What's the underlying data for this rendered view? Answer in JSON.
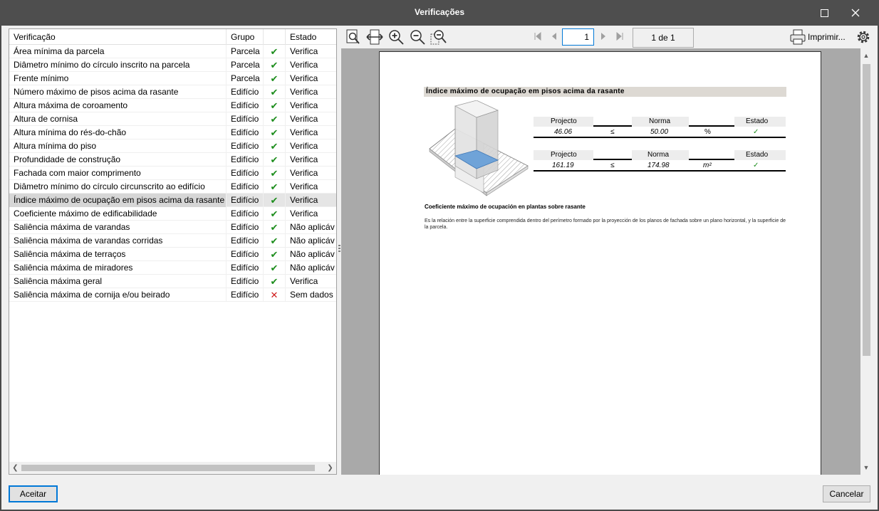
{
  "window": {
    "title": "Verificações"
  },
  "list": {
    "columns": {
      "name": "Verificação",
      "group": "Grupo",
      "state": "Estado"
    },
    "rows": [
      {
        "name": "Área mínima da parcela",
        "group": "Parcela",
        "status": "ok",
        "state": "Verifica"
      },
      {
        "name": "Diâmetro mínimo do círculo inscrito na parcela",
        "group": "Parcela",
        "status": "ok",
        "state": "Verifica"
      },
      {
        "name": "Frente mínimo",
        "group": "Parcela",
        "status": "ok",
        "state": "Verifica"
      },
      {
        "name": "Número máximo de pisos acima da rasante",
        "group": "Edifício",
        "status": "ok",
        "state": "Verifica"
      },
      {
        "name": "Altura máxima de coroamento",
        "group": "Edifício",
        "status": "ok",
        "state": "Verifica"
      },
      {
        "name": "Altura de cornisa",
        "group": "Edifício",
        "status": "ok",
        "state": "Verifica"
      },
      {
        "name": "Altura mínima do rés-do-chão",
        "group": "Edifício",
        "status": "ok",
        "state": "Verifica"
      },
      {
        "name": "Altura mínima do piso",
        "group": "Edifício",
        "status": "ok",
        "state": "Verifica"
      },
      {
        "name": "Profundidade de construção",
        "group": "Edifício",
        "status": "ok",
        "state": "Verifica"
      },
      {
        "name": "Fachada com maior comprimento",
        "group": "Edifício",
        "status": "ok",
        "state": "Verifica"
      },
      {
        "name": "Diâmetro mínimo do círculo circunscrito ao edifício",
        "group": "Edifício",
        "status": "ok",
        "state": "Verifica"
      },
      {
        "name": "Índice máximo de ocupação em pisos acima da rasante",
        "group": "Edifício",
        "status": "ok",
        "state": "Verifica",
        "selected": true
      },
      {
        "name": "Coeficiente máximo de edificabilidade",
        "group": "Edifício",
        "status": "ok",
        "state": "Verifica"
      },
      {
        "name": "Saliência máxima de varandas",
        "group": "Edifício",
        "status": "ok",
        "state": "Não aplicáv"
      },
      {
        "name": "Saliência máxima de varandas corridas",
        "group": "Edifício",
        "status": "ok",
        "state": "Não aplicáv"
      },
      {
        "name": "Saliência máxima de terraços",
        "group": "Edifício",
        "status": "ok",
        "state": "Não aplicáv"
      },
      {
        "name": "Saliência máxima de miradores",
        "group": "Edifício",
        "status": "ok",
        "state": "Não aplicáv"
      },
      {
        "name": "Saliência máxima geral",
        "group": "Edifício",
        "status": "ok",
        "state": "Verifica"
      },
      {
        "name": "Saliência máxima de cornija e/ou beirado",
        "group": "Edifício",
        "status": "fail",
        "state": "Sem dados"
      }
    ]
  },
  "toolbar": {
    "page_value": "1",
    "page_of": "1 de 1",
    "print_label": "Imprimir...",
    "icons": [
      "zoom-fit-icon",
      "fit-width-icon",
      "zoom-in-icon",
      "zoom-out-icon",
      "zoom-area-icon",
      "first-page-icon",
      "previous-page-icon",
      "next-page-icon",
      "last-page-icon",
      "printer-icon",
      "gear-icon"
    ]
  },
  "report": {
    "title": "Índice máximo de ocupação em pisos acima da rasante",
    "table1": {
      "h_project": "Projecto",
      "h_norm": "Norma",
      "h_state": "Estado",
      "project": "46.06",
      "op": "≤",
      "norm": "50.00",
      "unit": "%",
      "state": "✓"
    },
    "table2": {
      "h_project": "Projecto",
      "h_norm": "Norma",
      "h_state": "Estado",
      "project": "161.19",
      "op": "≤",
      "norm": "174.98",
      "unit": "m²",
      "state": "✓"
    },
    "desc_title": "Coeficiente máximo de ocupación en plantas sobre rasante",
    "desc_text": "Es la relación entre la superficie comprendida dentro del perímetro formado por la proyección de los planos de fachada sobre un plano horizontal, y la superficie de la parcela."
  },
  "buttons": {
    "accept": "Aceitar",
    "cancel": "Cancelar"
  },
  "colors": {
    "check": "#1c8d1c",
    "cross": "#cf1a1a",
    "accent": "#0078d7"
  }
}
